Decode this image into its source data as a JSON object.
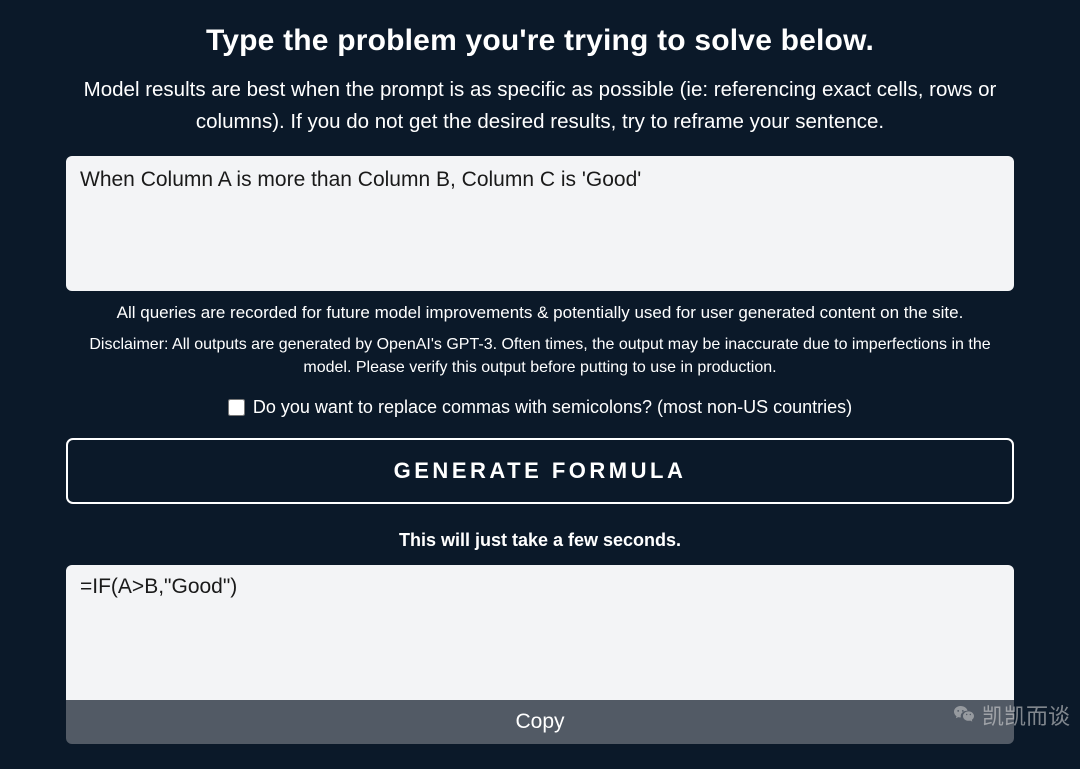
{
  "header": {
    "title": "Type the problem you're trying to solve below.",
    "subtitle": "Model results are best when the prompt is as specific as possible (ie: referencing exact cells, rows or columns). If you do not get the desired results, try to reframe your sentence."
  },
  "input": {
    "value": "When Column A is more than Column B, Column C is 'Good'"
  },
  "notes": {
    "recording": "All queries are recorded for future model improvements & potentially used for user generated content on the site.",
    "disclaimer": "Disclaimer: All outputs are generated by OpenAI's GPT-3. Often times, the output may be inaccurate due to imperfections in the model. Please verify this output before putting to use in production."
  },
  "checkbox": {
    "label": "Do you want to replace commas with semicolons? (most non-US countries)"
  },
  "generate": {
    "label": "GENERATE FORMULA"
  },
  "wait": {
    "text": "This will just take a few seconds."
  },
  "output": {
    "value": "=IF(A>B,\"Good\")"
  },
  "copy": {
    "label": "Copy"
  },
  "watermark": {
    "text": "凯凯而谈"
  }
}
